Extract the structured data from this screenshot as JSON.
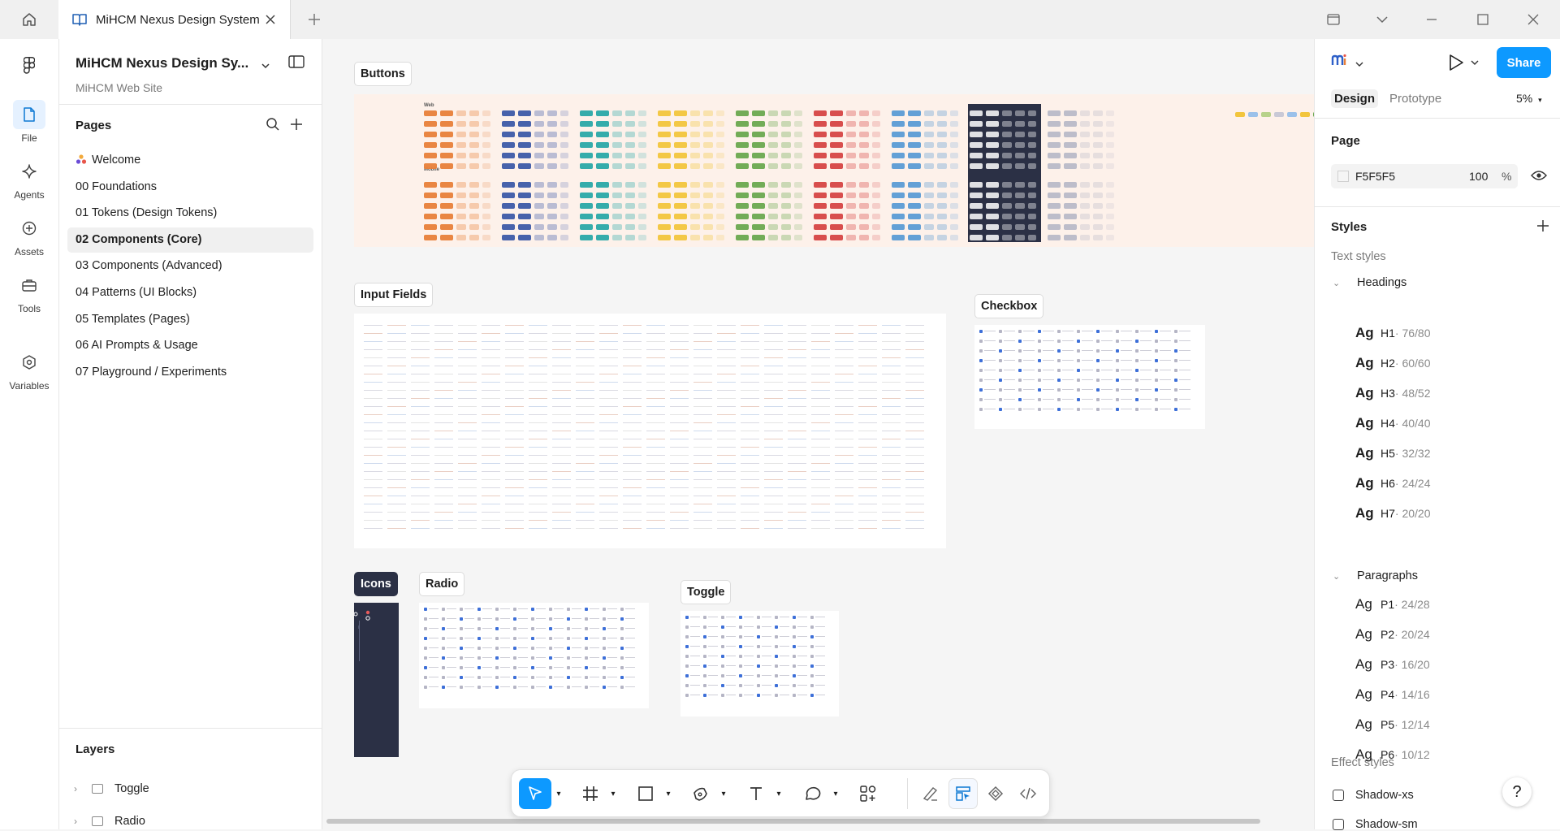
{
  "window": {
    "tab_title": "MiHCM Nexus Design System"
  },
  "rail": {
    "items": [
      {
        "label": "File",
        "icon": "file-icon"
      },
      {
        "label": "Agents",
        "icon": "sparkle-icon"
      },
      {
        "label": "Assets",
        "icon": "add-circle-icon"
      },
      {
        "label": "Tools",
        "icon": "toolbox-icon"
      },
      {
        "label": "Variables",
        "icon": "hexagon-icon"
      }
    ]
  },
  "file": {
    "title": "MiHCM Nexus Design Sy...",
    "subtitle": "MiHCM Web Site"
  },
  "pages": {
    "title": "Pages",
    "items": [
      {
        "label": "Welcome"
      },
      {
        "label": "00 Foundations"
      },
      {
        "label": "01 Tokens (Design Tokens)"
      },
      {
        "label": "02 Components (Core)"
      },
      {
        "label": "03 Components (Advanced)"
      },
      {
        "label": "04 Patterns (UI Blocks)"
      },
      {
        "label": "05 Templates (Pages)"
      },
      {
        "label": "06 AI Prompts & Usage"
      },
      {
        "label": "07 Playground / Experiments"
      }
    ],
    "active_index": 3
  },
  "layers": {
    "title": "Layers",
    "items": [
      {
        "label": "Toggle"
      },
      {
        "label": "Radio"
      }
    ]
  },
  "canvas": {
    "sections": {
      "buttons": "Buttons",
      "input_fields": "Input Fields",
      "checkbox": "Checkbox",
      "icons": "Icons",
      "radio": "Radio",
      "toggle": "Toggle"
    },
    "buttons_frame": {
      "row_labels": [
        "Web",
        "Mobile"
      ],
      "palette": [
        "#e8803a",
        "#3d5aa8",
        "#2aa8a8",
        "#f2c53d",
        "#6aa84f",
        "#d64545",
        "#5b9bd5",
        "#2b3045",
        "#b9b9c8"
      ]
    }
  },
  "toolbar": {
    "tools": [
      {
        "name": "move-tool",
        "icon": "cursor-icon"
      },
      {
        "name": "frame-tool",
        "icon": "hash-icon"
      },
      {
        "name": "shape-tool",
        "icon": "rectangle-icon"
      },
      {
        "name": "pen-tool",
        "icon": "pen-icon"
      },
      {
        "name": "text-tool",
        "icon": "text-icon"
      },
      {
        "name": "comment-tool",
        "icon": "comment-icon"
      },
      {
        "name": "actions-tool",
        "icon": "actions-icon"
      },
      {
        "name": "draw-mode",
        "icon": "draw-icon"
      },
      {
        "name": "design-mode",
        "icon": "design-icon"
      },
      {
        "name": "prototype-mode",
        "icon": "diamond-icon"
      },
      {
        "name": "dev-mode",
        "icon": "code-icon"
      }
    ]
  },
  "right": {
    "share": "Share",
    "tabs": {
      "design": "Design",
      "prototype": "Prototype"
    },
    "zoom": "5%",
    "page": {
      "title": "Page",
      "color": "F5F5F5",
      "opacity": "100",
      "percent": "%"
    },
    "styles": {
      "title": "Styles",
      "text_styles": "Text styles",
      "headings_label": "Headings",
      "headings": [
        {
          "name": "H1",
          "value": " · 76/80"
        },
        {
          "name": "H2",
          "value": " · 60/60"
        },
        {
          "name": "H3",
          "value": " · 48/52"
        },
        {
          "name": "H4",
          "value": " · 40/40"
        },
        {
          "name": "H5",
          "value": " · 32/32"
        },
        {
          "name": "H6",
          "value": " · 24/24"
        },
        {
          "name": "H7",
          "value": " · 20/20"
        }
      ],
      "paragraphs_label": "Paragraphs",
      "paragraphs": [
        {
          "name": "P1",
          "value": " · 24/28"
        },
        {
          "name": "P2",
          "value": " · 20/24"
        },
        {
          "name": "P3",
          "value": " · 16/20"
        },
        {
          "name": "P4",
          "value": " · 14/16"
        },
        {
          "name": "P5",
          "value": " · 12/14"
        },
        {
          "name": "P6",
          "value": " · 10/12"
        }
      ],
      "ag": "Ag",
      "effect_styles": "Effect styles",
      "effects": [
        {
          "name": "Shadow-xs"
        },
        {
          "name": "Shadow-sm"
        }
      ]
    },
    "help": "?"
  }
}
